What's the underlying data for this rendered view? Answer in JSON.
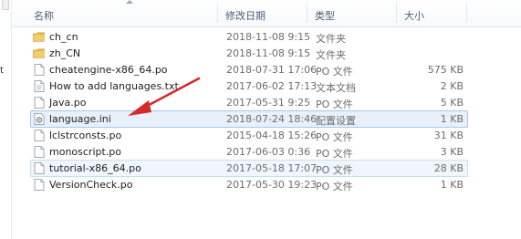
{
  "columns": {
    "name": "名称",
    "date": "修改日期",
    "type": "类型",
    "size": "大小"
  },
  "left_pane_peek": "t",
  "files": [
    {
      "name": "ch_cn",
      "date": "2018-11-08 9:15",
      "type": "文件夹",
      "size": "",
      "icon": "folder-icon"
    },
    {
      "name": "zh_CN",
      "date": "2018-11-08 9:15",
      "type": "文件夹",
      "size": "",
      "icon": "folder-icon"
    },
    {
      "name": "cheatengine-x86_64.po",
      "date": "2018-07-31 17:06",
      "type": "PO 文件",
      "size": "575 KB",
      "icon": "document-icon"
    },
    {
      "name": "How to add languages.txt",
      "date": "2017-06-02 17:13",
      "type": "文本文档",
      "size": "2 KB",
      "icon": "text-document-icon"
    },
    {
      "name": "Java.po",
      "date": "2017-05-31 9:25",
      "type": "PO 文件",
      "size": "5 KB",
      "icon": "document-icon"
    },
    {
      "name": "language.ini",
      "date": "2018-07-24 18:46",
      "type": "配置设置",
      "size": "1 KB",
      "icon": "settings-file-icon"
    },
    {
      "name": "lclstrconsts.po",
      "date": "2015-04-18 15:26",
      "type": "PO 文件",
      "size": "31 KB",
      "icon": "document-icon"
    },
    {
      "name": "monoscript.po",
      "date": "2017-06-03 0:36",
      "type": "PO 文件",
      "size": "3 KB",
      "icon": "document-icon"
    },
    {
      "name": "tutorial-x86_64.po",
      "date": "2017-05-18 17:07",
      "type": "PO 文件",
      "size": "28 KB",
      "icon": "document-icon"
    },
    {
      "name": "VersionCheck.po",
      "date": "2017-05-30 19:23",
      "type": "PO 文件",
      "size": "1 KB",
      "icon": "document-icon"
    }
  ],
  "highlighted_file": "language.ini",
  "hovered_file": "tutorial-x86_64.po",
  "annotation_arrow_color": "#d42a2a",
  "folder_color": "#e8b64a"
}
